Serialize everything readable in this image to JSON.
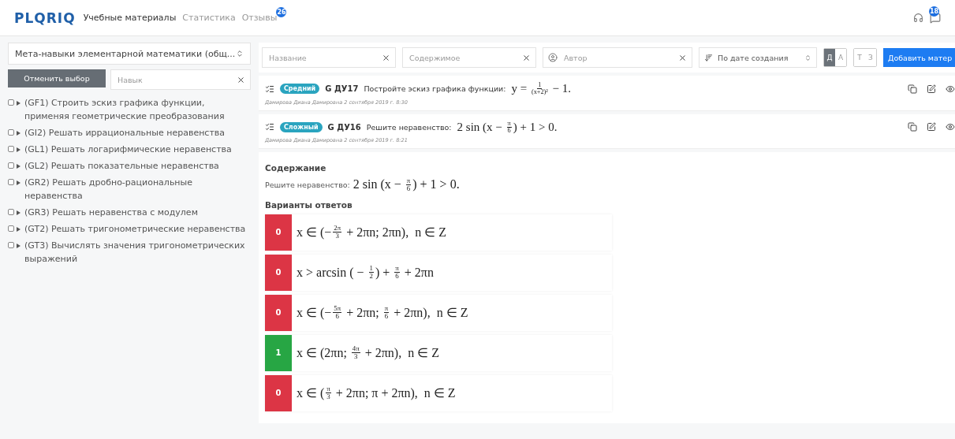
{
  "nav": {
    "logo": "PLQRIQ",
    "links": [
      {
        "label": "Учебные материалы",
        "selected": true
      },
      {
        "label": "Статистика",
        "selected": false
      },
      {
        "label": "Отзывы",
        "selected": false,
        "badge": "26"
      }
    ],
    "messages_badge": "18"
  },
  "sidebar": {
    "course_select": "Мета-навыки элементарной математики (общ...",
    "clear_button": "Отменить выбор",
    "skill_search": {
      "placeholder": "Навык"
    },
    "skills": [
      {
        "label": "(GF1) Строить эскиз графика функции, применяя геометрические преобразования",
        "checked": false
      },
      {
        "label": "(GI2) Решать иррациональные неравенства",
        "checked": false
      },
      {
        "label": "(GL1) Решать логарифмические неравенства",
        "checked": false
      },
      {
        "label": "(GL2) Решать показательные неравенства",
        "checked": false
      },
      {
        "label": "(GR2) Решать дробно-рациональные неравенства",
        "checked": false
      },
      {
        "label": "(GR3) Решать неравенства с модулем",
        "checked": false
      },
      {
        "label": "(GT2) Решать тригонометрические неравенства",
        "checked": false
      },
      {
        "label": "(GT3) Вычислять значения тригонометрических выражений",
        "checked": false
      }
    ]
  },
  "filters": {
    "name": {
      "placeholder": "Название"
    },
    "content": {
      "placeholder": "Содержимое"
    },
    "author": {
      "placeholder": "Автор"
    },
    "sort": "По дате создания",
    "toggle_groups": [
      [
        {
          "label": "Д",
          "selected": true
        },
        {
          "label": "А",
          "selected": false
        }
      ],
      [
        {
          "label": "Т",
          "selected": false
        },
        {
          "label": "З",
          "selected": false
        }
      ]
    ],
    "add_button": "Добавить матер"
  },
  "tasks": [
    {
      "level": "Средний",
      "code": "G ДУ17",
      "text": "Постройте эскиз графика функции:",
      "formula": [
        {
          "kind": "t",
          "text": "y = "
        },
        {
          "kind": "f",
          "num": "1",
          "den": "(x+2)²"
        },
        {
          "kind": "t",
          "text": " − 1."
        }
      ],
      "meta": "Дамирова Диана Дамировна   2 сентября 2019 г. 8:30"
    },
    {
      "level": "Сложный",
      "code": "G ДУ16",
      "text": "Решите неравенство:",
      "formula": [
        {
          "kind": "t",
          "text": "2 sin (x − "
        },
        {
          "kind": "f",
          "num": "π",
          "den": "6"
        },
        {
          "kind": "t",
          "text": ") + 1 > 0."
        }
      ],
      "meta": "Дамирова Диана Дамировна   2 сентября 2019 г. 8:21"
    }
  ],
  "details": {
    "content_heading": "Содержание",
    "content_text": "Решите неравенство:",
    "content_formula": [
      {
        "kind": "t",
        "text": "2 sin (x − "
      },
      {
        "kind": "f",
        "num": "π",
        "den": "6"
      },
      {
        "kind": "t",
        "text": ") + 1 > 0."
      }
    ],
    "answers_heading": "Варианты ответов",
    "answers": [
      {
        "score": "0",
        "correct": false,
        "formula": [
          {
            "kind": "t",
            "text": "x ∈ (−"
          },
          {
            "kind": "f",
            "num": "2π",
            "den": "3"
          },
          {
            "kind": "t",
            "text": " + 2πn; 2πn),  n ∈ Z"
          }
        ]
      },
      {
        "score": "0",
        "correct": false,
        "formula": [
          {
            "kind": "t",
            "text": "x > arcsin ( − "
          },
          {
            "kind": "f",
            "num": "1",
            "den": "2"
          },
          {
            "kind": "t",
            "text": ") + "
          },
          {
            "kind": "f",
            "num": "π",
            "den": "6"
          },
          {
            "kind": "t",
            "text": " + 2πn"
          }
        ]
      },
      {
        "score": "0",
        "correct": false,
        "formula": [
          {
            "kind": "t",
            "text": "x ∈ (−"
          },
          {
            "kind": "f",
            "num": "5π",
            "den": "6"
          },
          {
            "kind": "t",
            "text": " + 2πn; "
          },
          {
            "kind": "f",
            "num": "π",
            "den": "6"
          },
          {
            "kind": "t",
            "text": " + 2πn),  n ∈ Z"
          }
        ]
      },
      {
        "score": "1",
        "correct": true,
        "formula": [
          {
            "kind": "t",
            "text": "x ∈ (2πn; "
          },
          {
            "kind": "f",
            "num": "4π",
            "den": "3"
          },
          {
            "kind": "t",
            "text": " + 2πn),  n ∈ Z"
          }
        ]
      },
      {
        "score": "0",
        "correct": false,
        "formula": [
          {
            "kind": "t",
            "text": "x ∈ ("
          },
          {
            "kind": "f",
            "num": "π",
            "den": "3"
          },
          {
            "kind": "t",
            "text": " + 2πn; π + 2πn),  n ∈ Z"
          }
        ]
      }
    ]
  }
}
